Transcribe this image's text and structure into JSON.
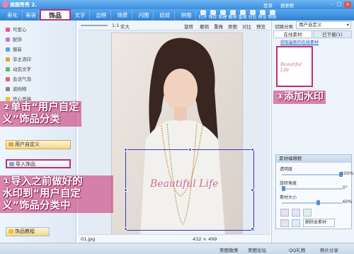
{
  "titlebar": {
    "app_name": "美图秀秀 2.",
    "right_links": [
      "登录",
      "搜索框"
    ]
  },
  "tabs": [
    "美化",
    "饰品",
    "文字",
    "边框",
    "场景",
    "闪图",
    "娃娃",
    "拼图"
  ],
  "active_tab_index": 1,
  "toolbar": [
    "打开",
    "保存",
    "新建",
    "撤销",
    "重做",
    "对比",
    "预览",
    "帮助"
  ],
  "canvas_bar": {
    "fit": "1:1",
    "fit2": "实大",
    "rotate": "旋转",
    "undo": "撤销",
    "redo": "重做",
    "original": "原图",
    "compare": "对比",
    "preview": "预览"
  },
  "left_nav": [
    {
      "label": "可爱心",
      "color": "#e85a8f"
    },
    {
      "label": "配饰",
      "color": "#c07ad0"
    },
    {
      "label": "服装",
      "color": "#5aa0e6"
    },
    {
      "label": "非主流印",
      "color": "#e8a040"
    },
    {
      "label": "动态文字",
      "color": "#60b870"
    },
    {
      "label": "会话气泡",
      "color": "#e86060"
    },
    {
      "label": "遮挡物",
      "color": "#888888"
    },
    {
      "label": "开心恶搞",
      "color": "#f0c030"
    }
  ],
  "category_buttons": {
    "custom": "用户自定义",
    "import": "导入饰品",
    "tutorial": "饰品教程"
  },
  "callouts": {
    "step2_line1": "②单击“用户自定",
    "step2_line2": "义”饰品分类",
    "step1_line1": "①导入之前做好的",
    "step1_line2": "水印到“用户自定",
    "step1_line3": "义”饰品分类中",
    "step3": "③添加水印"
  },
  "right_panel": {
    "switch_label": "切换分类",
    "category_value": "用户自定义",
    "tab_online": "在线素材",
    "tab_downloaded": "已下载(1)",
    "get_more": "获取最新的在线素材"
  },
  "watermark_text": "Beautiful Life",
  "editor": {
    "title": "素材编辑框",
    "opacity_label": "透明度",
    "opacity_value": "100%",
    "opacity_level": 1.0,
    "rotate_label": "旋转角度",
    "rotate_value": "0°",
    "rotate_level": 0.0,
    "size_label": "素材大小",
    "size_value": "60%",
    "size_level": 0.6,
    "delete_label": "删除本素材"
  },
  "status": {
    "filename": "01.jpg",
    "dimensions": "432 × 499"
  },
  "bottom_bar": [
    "美图微博",
    "美图论坛",
    "QQ礼物",
    "照片分享"
  ]
}
